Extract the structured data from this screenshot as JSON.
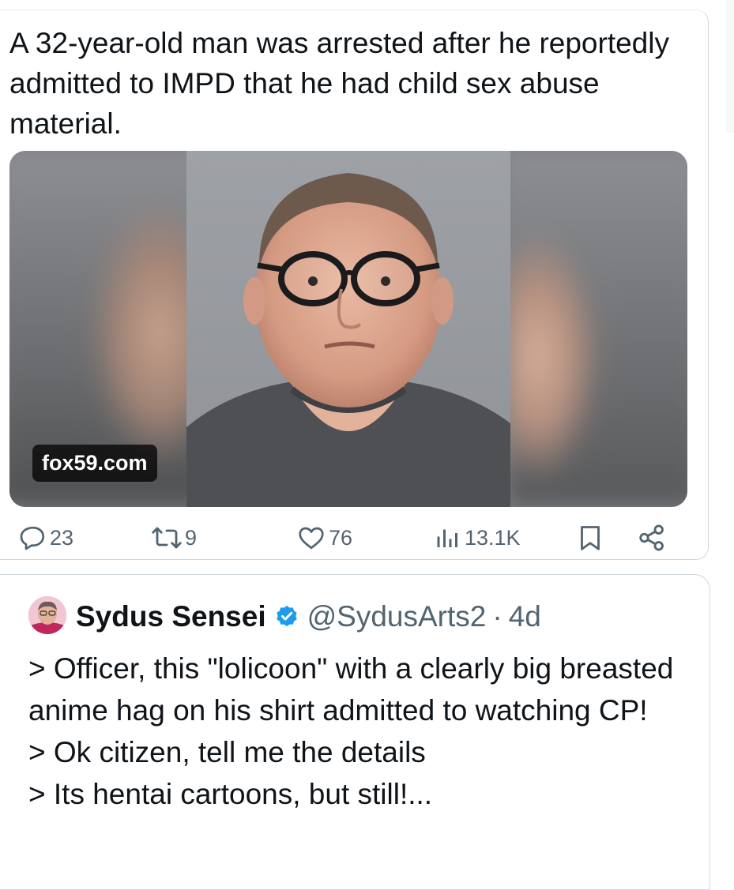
{
  "tweet": {
    "text": "A 32-year-old man was arrested after he reportedly admitted to IMPD that he had child sex abuse material.",
    "media": {
      "source": "fox59.com"
    },
    "actions": {
      "replies": "23",
      "reposts": "9",
      "likes": "76",
      "views": "13.1K"
    }
  },
  "quote": {
    "author_name": "Sydus Sensei",
    "handle": "@SydusArts2",
    "separator": "·",
    "time": "4d",
    "lines": [
      "> Officer, this \"lolicoon\" with a clearly big breasted anime hag on his shirt admitted to watching CP!",
      "> Ok citizen, tell me the details",
      "> Its hentai cartoons, but still!..."
    ]
  },
  "colors": {
    "text": "#0f1419",
    "secondary": "#536471",
    "verified": "#1d9bf0",
    "border": "#cfd9de"
  },
  "icons": [
    "reply-icon",
    "repost-icon",
    "like-icon",
    "views-icon",
    "bookmark-icon",
    "share-icon",
    "verified-badge-icon"
  ]
}
